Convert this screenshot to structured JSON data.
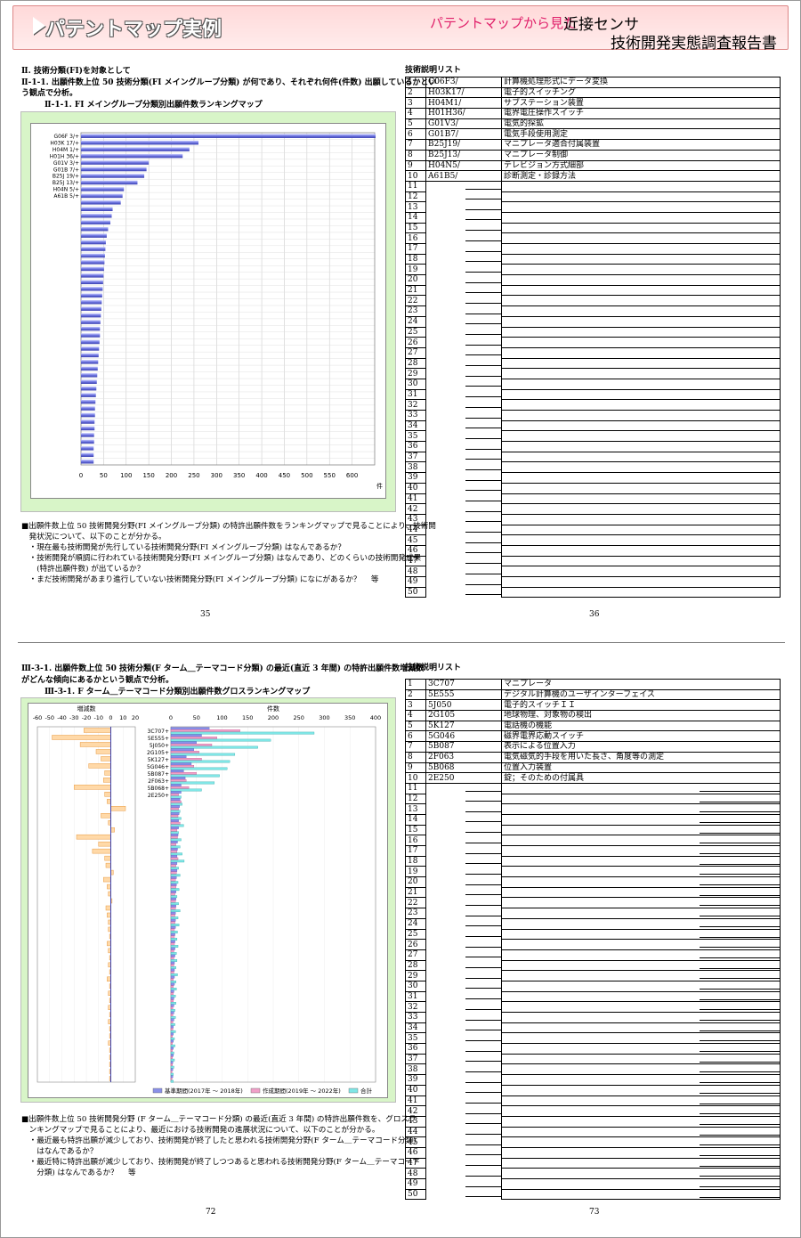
{
  "banner": {
    "title": "パテントマップ実例",
    "sub_pink": "パテントマップから見た",
    "sub_black": "近接センサ",
    "line2": "技術開発実態調査報告書"
  },
  "top": {
    "section": "Ⅱ. 技術分類(FI)を対象として",
    "heading1": "Ⅱ-1-1. 出願件数上位 50 技術分類(FI メイングループ分類) が何であり、それぞれ何件(件数) 出願しているかとい",
    "heading2": "う観点で分析。",
    "chart_title": "Ⅱ-1-1. FI メイングループ分類別出願件数ランキングマップ",
    "unit": "件",
    "notes": [
      "■出願件数上位 50 技術開発分野(FI メイングループ分類) の特許出願件数をランキングマップで見ることにより、技術開",
      "　発状況について、以下のことが分かる。",
      "　・現在最も技術開発が先行している技術開発分野(FI メイングループ分類) はなんであるか？",
      "　・技術開発が順調に行われている技術開発分野(FI メイングループ分類) はなんであり、どのくらいの技術開発成果",
      "　　(特許出願件数) が出ているか？",
      "　・まだ技術開発があまり進行していない技術開発分野(FI メイングループ分類) になにがあるか？　 等"
    ],
    "page_left": "35",
    "page_right": "36",
    "list_title": "技術説明リスト",
    "list": [
      [
        "1",
        "G06F3/",
        "計算機処理形式にデータ変換"
      ],
      [
        "2",
        "H03K17/",
        "電子的スイッチング"
      ],
      [
        "3",
        "H04M1/",
        "サブステーション装置"
      ],
      [
        "4",
        "H01H36/",
        "電界電圧操作スイッチ"
      ],
      [
        "5",
        "G01V3/",
        "電気的探鉱"
      ],
      [
        "6",
        "G01B7/",
        "電気手段使用測定"
      ],
      [
        "7",
        "B25J19/",
        "マニプレータ適合付属装置"
      ],
      [
        "8",
        "B25J13/",
        "マニプレータ制御"
      ],
      [
        "9",
        "H04N5/",
        "テレビジョン方式細部"
      ],
      [
        "10",
        "A61B5/",
        "診断測定・診録方法"
      ]
    ]
  },
  "bottom": {
    "heading1": "Ⅲ-3-1. 出願件数上位 50 技術分類(F ターム＿テーマコード分類) の最近(直近 3 年間) の特許出願件数増減数",
    "heading2": "がどんな傾向にあるかという観点で分析。",
    "chart_title": "Ⅲ-3-1. F ターム＿テーマコード分類別出願件数グロスランキングマップ",
    "left_axis_title": "増減数",
    "right_axis_title": "件数",
    "legend": [
      "基準期間(2017年 ～ 2018年)",
      "作成期間(2019年 ～ 2022年)",
      "合計"
    ],
    "notes": [
      "■出願件数上位 50 技術開発分野 (F ターム＿テーマコード分類) の最近(直近 3 年間) の特許出願件数を、グロスラ",
      "　ンキングマップで見ることにより、最近における技術開発の進展状況について、以下のことが分かる。",
      "　・最近最も特許出願が減少しており、技術開発が終了したと思われる技術開発分野(F ターム＿テーマコード分類)",
      "　　はなんであるか？",
      "　・最近特に特許出願が減少しており、技術開発が終了しつつあると思われる技術開発分野(F ターム＿テーマコード",
      "　　分類) はなんであるか？　 等"
    ],
    "page_left": "72",
    "page_right": "73",
    "list_title": "技術説明リスト",
    "list": [
      [
        "1",
        "3C707",
        "マニプレータ"
      ],
      [
        "2",
        "5E555",
        "デジタル計算機のユーザインターフェイス"
      ],
      [
        "3",
        "5J050",
        "電子的スイッチＩＩ"
      ],
      [
        "4",
        "2G105",
        "地球物理、対象物の検出"
      ],
      [
        "5",
        "5K127",
        "電話機の機能"
      ],
      [
        "6",
        "5G046",
        "磁界電界応動スイッチ"
      ],
      [
        "7",
        "5B087",
        "表示による位置入力"
      ],
      [
        "8",
        "2F063",
        "電気磁気的手段を用いた長さ、角度等の測定"
      ],
      [
        "9",
        "5B068",
        "位置入力装置"
      ],
      [
        "10",
        "2E250",
        "錠；そのための付属具"
      ]
    ]
  },
  "chart_data": [
    {
      "type": "bar",
      "orientation": "horizontal",
      "title": "Ⅱ-1-1. FI メイングループ分類別出願件数ランキングマップ",
      "xlabel": "件",
      "xlim": [
        0,
        650
      ],
      "xticks": [
        0,
        50,
        100,
        150,
        200,
        250,
        300,
        350,
        400,
        450,
        500,
        550,
        600
      ],
      "categories": [
        "G06F 3/+",
        "H03K 17/+",
        "H04M 1/+",
        "H01H 36/+",
        "G01V 3/+",
        "G01B 7/+",
        "B25J 19/+",
        "B25J 13/+",
        "H04N 5/+",
        "A61B 5/+"
      ],
      "values": [
        652,
        260,
        240,
        225,
        150,
        145,
        140,
        125,
        95,
        92,
        88,
        70,
        68,
        65,
        60,
        57,
        55,
        54,
        53,
        52,
        51,
        50,
        49,
        48,
        47,
        46,
        45,
        44,
        43,
        42,
        42,
        41,
        40,
        39,
        38,
        37,
        36,
        35,
        34,
        33,
        32,
        31,
        31,
        30,
        30,
        29,
        29,
        28,
        28,
        28
      ]
    },
    {
      "type": "bar",
      "orientation": "horizontal",
      "title": "Ⅲ-3-1. F ターム＿テーマコード分類別出願件数グロスランキングマップ",
      "left_xlabel": "増減数",
      "left_xlim": [
        -60,
        20
      ],
      "left_xticks": [
        -60,
        -50,
        -40,
        -30,
        -20,
        -10,
        0,
        10,
        20
      ],
      "right_xlabel": "件数",
      "right_xlim": [
        0,
        400
      ],
      "right_xticks": [
        0,
        50,
        100,
        150,
        200,
        250,
        300,
        350,
        400
      ],
      "categories": [
        "3C707+",
        "5E555+",
        "5J050+",
        "2G105+",
        "5K127+",
        "5G046+",
        "5B087+",
        "2F063+",
        "5B068+",
        "2E250+"
      ],
      "series": [
        {
          "name": "基準期間(2017年 ～ 2018年)",
          "values": [
            75,
            60,
            50,
            45,
            30,
            40,
            25,
            28,
            20,
            20,
            18,
            17,
            16,
            15,
            15,
            14,
            13,
            13,
            12,
            12,
            12,
            11,
            11,
            10,
            10,
            10,
            9,
            9,
            9,
            8,
            8,
            8,
            8,
            7,
            7,
            7,
            7,
            6,
            6,
            6,
            6,
            6,
            5,
            5,
            5,
            5,
            5,
            4,
            4,
            4
          ]
        },
        {
          "name": "作成期間(2019年 ～ 2022年)",
          "values": [
            135,
            90,
            80,
            55,
            60,
            45,
            50,
            30,
            35,
            15,
            20,
            15,
            14,
            18,
            12,
            13,
            10,
            12,
            14,
            10,
            11,
            9,
            10,
            8,
            9,
            9,
            8,
            8,
            7,
            7,
            7,
            6,
            6,
            6,
            6,
            5,
            5,
            5,
            5,
            4,
            4,
            4,
            4,
            3,
            3,
            3,
            3,
            3,
            2,
            2
          ]
        },
        {
          "name": "合計",
          "values": [
            280,
            195,
            170,
            125,
            115,
            110,
            95,
            85,
            60,
            20,
            22,
            18,
            20,
            25,
            15,
            20,
            18,
            22,
            26,
            15,
            18,
            14,
            16,
            12,
            15,
            18,
            14,
            16,
            13,
            12,
            14,
            11,
            12,
            10,
            13,
            10,
            11,
            9,
            10,
            8,
            9,
            8,
            9,
            7,
            8,
            6,
            7,
            6,
            5,
            5
          ]
        },
        {
          "name": "増減数",
          "values": [
            -22,
            -48,
            -25,
            -12,
            -8,
            -18,
            -5,
            -6,
            -30,
            -5,
            -3,
            12,
            -8,
            -2,
            3,
            -28,
            -10,
            -15,
            -5,
            -4,
            2,
            -6,
            -3,
            -2,
            1,
            -4,
            -3,
            -2,
            -2,
            -1,
            -3,
            -2,
            -1,
            -2,
            -1,
            -3,
            -1,
            -2,
            -1,
            -2,
            -1,
            -2,
            -1,
            -1,
            -2,
            -1,
            -1,
            -1,
            -1,
            -1
          ]
        }
      ]
    }
  ]
}
